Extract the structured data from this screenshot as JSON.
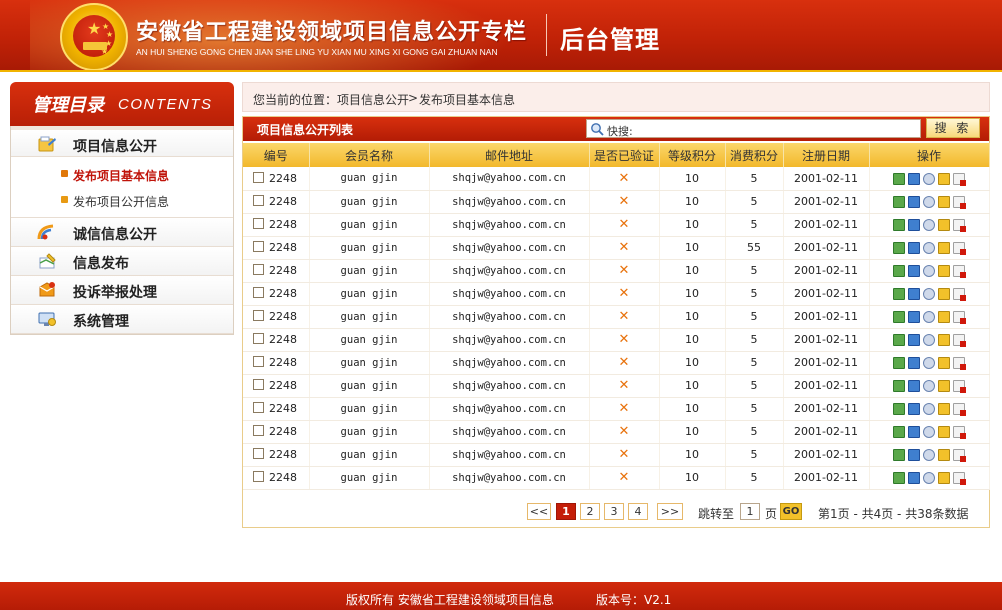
{
  "header": {
    "site_title": "安徽省工程建设领域项目信息公开专栏",
    "site_pinyin": "AN HUI SHENG GONG CHEN JIAN SHE LING YU XIAN MU  XING XI  GONG GAI ZHUAN NAN",
    "admin_title": "后台管理"
  },
  "sidebar": {
    "title_cn": "管理目录",
    "title_en": "CONTENTS",
    "menu": [
      {
        "label": "项目信息公开",
        "icon": "project-info-icon"
      },
      {
        "label": "诚信信息公开",
        "icon": "credit-info-icon"
      },
      {
        "label": "信息发布",
        "icon": "publish-icon"
      },
      {
        "label": "投诉举报处理",
        "icon": "complaint-icon"
      },
      {
        "label": "系统管理",
        "icon": "system-icon"
      }
    ],
    "submenu": [
      {
        "label": "发布项目基本信息",
        "active": true
      },
      {
        "label": "发布项目公开信息",
        "active": false
      }
    ]
  },
  "breadcrumb": {
    "prefix": "您当前的位置：",
    "path1": "项目信息公开",
    "sep": ">",
    "path2": "发布项目基本信息"
  },
  "panel": {
    "title": "项目信息公开列表",
    "search_label": "快搜:",
    "search_button": "搜 索"
  },
  "table": {
    "columns": [
      "编号",
      "会员名称",
      "邮件地址",
      "是否已验证",
      "等级积分",
      "消费积分",
      "注册日期",
      "操作"
    ],
    "rows": [
      {
        "id": "2248",
        "name": "guan gjin",
        "email": "shqjw@yahoo.com.cn",
        "verified": "✕",
        "level": "10",
        "spend": "5",
        "date": "2001-02-11"
      },
      {
        "id": "2248",
        "name": "guan gjin",
        "email": "shqjw@yahoo.com.cn",
        "verified": "✕",
        "level": "10",
        "spend": "5",
        "date": "2001-02-11"
      },
      {
        "id": "2248",
        "name": "guan gjin",
        "email": "shqjw@yahoo.com.cn",
        "verified": "✕",
        "level": "10",
        "spend": "5",
        "date": "2001-02-11"
      },
      {
        "id": "2248",
        "name": "guan gjin",
        "email": "shqjw@yahoo.com.cn",
        "verified": "✕",
        "level": "10",
        "spend": "55",
        "date": "2001-02-11"
      },
      {
        "id": "2248",
        "name": "guan gjin",
        "email": "shqjw@yahoo.com.cn",
        "verified": "✕",
        "level": "10",
        "spend": "5",
        "date": "2001-02-11"
      },
      {
        "id": "2248",
        "name": "guan gjin",
        "email": "shqjw@yahoo.com.cn",
        "verified": "✕",
        "level": "10",
        "spend": "5",
        "date": "2001-02-11"
      },
      {
        "id": "2248",
        "name": "guan gjin",
        "email": "shqjw@yahoo.com.cn",
        "verified": "✕",
        "level": "10",
        "spend": "5",
        "date": "2001-02-11"
      },
      {
        "id": "2248",
        "name": "guan gjin",
        "email": "shqjw@yahoo.com.cn",
        "verified": "✕",
        "level": "10",
        "spend": "5",
        "date": "2001-02-11"
      },
      {
        "id": "2248",
        "name": "guan gjin",
        "email": "shqjw@yahoo.com.cn",
        "verified": "✕",
        "level": "10",
        "spend": "5",
        "date": "2001-02-11"
      },
      {
        "id": "2248",
        "name": "guan gjin",
        "email": "shqjw@yahoo.com.cn",
        "verified": "✕",
        "level": "10",
        "spend": "5",
        "date": "2001-02-11"
      },
      {
        "id": "2248",
        "name": "guan gjin",
        "email": "shqjw@yahoo.com.cn",
        "verified": "✕",
        "level": "10",
        "spend": "5",
        "date": "2001-02-11"
      },
      {
        "id": "2248",
        "name": "guan gjin",
        "email": "shqjw@yahoo.com.cn",
        "verified": "✕",
        "level": "10",
        "spend": "5",
        "date": "2001-02-11"
      },
      {
        "id": "2248",
        "name": "guan gjin",
        "email": "shqjw@yahoo.com.cn",
        "verified": "✕",
        "level": "10",
        "spend": "5",
        "date": "2001-02-11"
      },
      {
        "id": "2248",
        "name": "guan gjin",
        "email": "shqjw@yahoo.com.cn",
        "verified": "✕",
        "level": "10",
        "spend": "5",
        "date": "2001-02-11"
      }
    ],
    "op_icons": [
      "edit-icon",
      "view-icon",
      "search-detail-icon",
      "lock-icon",
      "delete-icon"
    ]
  },
  "pager": {
    "prev": "<<",
    "pages": [
      "1",
      "2",
      "3",
      "4"
    ],
    "current": "1",
    "next": ">>",
    "jump_label": "跳转至",
    "jump_value": "1",
    "page_unit": "页",
    "go": "GO",
    "summary": "第1页 - 共4页 - 共38条数据"
  },
  "footer": {
    "copyright": "版权所有  安徽省工程建设领域项目信息",
    "version": "版本号：V2.1"
  },
  "colors": {
    "brand_red": "#c12207",
    "gold": "#f2b82b",
    "footer_red": "#b51c06"
  }
}
